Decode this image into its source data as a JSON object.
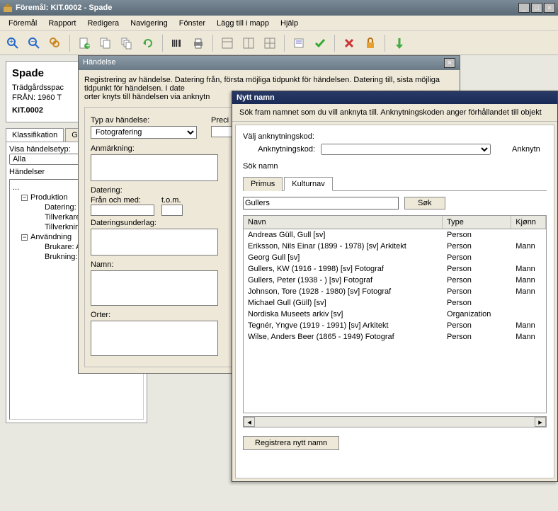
{
  "window": {
    "title": "Föremål: KIT.0002  - Spade"
  },
  "menu": [
    "Föremål",
    "Rapport",
    "Redigera",
    "Navigering",
    "Fönster",
    "Lägg till i mapp",
    "Hjälp"
  ],
  "summary": {
    "heading": "Spade",
    "line1": "Trädgårdsspac",
    "line2": "FRÅN:  1960 T",
    "code": "KIT.0002"
  },
  "leftTabs": [
    "Klassifikation",
    "Gru"
  ],
  "visLabel": "Visa händelsetyp:",
  "visValue": "Alla",
  "treeHeader": "Händelser",
  "tree": [
    {
      "label": "...",
      "lvl": 0
    },
    {
      "label": "Produktion",
      "lvl": 1,
      "exp": "-"
    },
    {
      "label": "Datering:",
      "lvl": 2
    },
    {
      "label": "Tillverkare",
      "lvl": 2
    },
    {
      "label": "Tillverknin",
      "lvl": 2
    },
    {
      "label": "Användning",
      "lvl": 1,
      "exp": "-"
    },
    {
      "label": "Brukare: A",
      "lvl": 2
    },
    {
      "label": "Brukning:",
      "lvl": 2
    }
  ],
  "mid": {
    "title": "Händelse",
    "desc": "Registrering av  händelse. Datering från, första möjliga tidpunkt för händelsen. Datering till, sista möjliga tidpunkt för händelsen. I date\norter knyts till händelsen via anknytn",
    "typLabel": "Typ av händelse:",
    "typValue": "Fotografering",
    "precLabel": "Preci",
    "anmLabel": "Anmärkning:",
    "datLabel": "Datering:",
    "datFrom": "Från och med:",
    "datTo": "t.o.m.",
    "datUndLabel": "Dateringsunderlag:",
    "namnLabel": "Namn:",
    "orterLabel": "Orter:"
  },
  "dlg": {
    "title": "Nytt namn",
    "hint": "Sök fram namnet som du vill anknyta till. Anknytningskoden anger förhållandet till objekt",
    "valj": "Välj anknytningskod:",
    "ankLabel": "Anknytningskod:",
    "ankRight": "Anknytn",
    "sokNamn": "Sök namn",
    "tabs": [
      "Primus",
      "Kulturnav"
    ],
    "searchValue": "Gullers",
    "searchBtn": "Søk",
    "cols": [
      "Navn",
      "Type",
      "Kjønn"
    ],
    "rows": [
      {
        "n": "Andreas Güll, Gull [sv]",
        "t": "Person",
        "k": ""
      },
      {
        "n": "Eriksson, Nils Einar (1899 - 1978) [sv] Arkitekt",
        "t": "Person",
        "k": "Mann"
      },
      {
        "n": "Georg Gull [sv]",
        "t": "Person",
        "k": ""
      },
      {
        "n": "Gullers, KW (1916 - 1998) [sv] Fotograf",
        "t": "Person",
        "k": "Mann"
      },
      {
        "n": "Gullers, Peter (1938 - ) [sv] Fotograf",
        "t": "Person",
        "k": "Mann"
      },
      {
        "n": "Johnson, Tore (1928 - 1980) [sv] Fotograf",
        "t": "Person",
        "k": "Mann"
      },
      {
        "n": "Michael Gull (Güll) [sv]",
        "t": "Person",
        "k": ""
      },
      {
        "n": "Nordiska Museets arkiv [sv]",
        "t": "Organization",
        "k": ""
      },
      {
        "n": "Tegnér, Yngve (1919 - 1991) [sv] Arkitekt",
        "t": "Person",
        "k": "Mann"
      },
      {
        "n": "Wilse, Anders Beer (1865 - 1949) Fotograf",
        "t": "Person",
        "k": "Mann"
      }
    ],
    "regBtn": "Registrera nytt namn"
  }
}
